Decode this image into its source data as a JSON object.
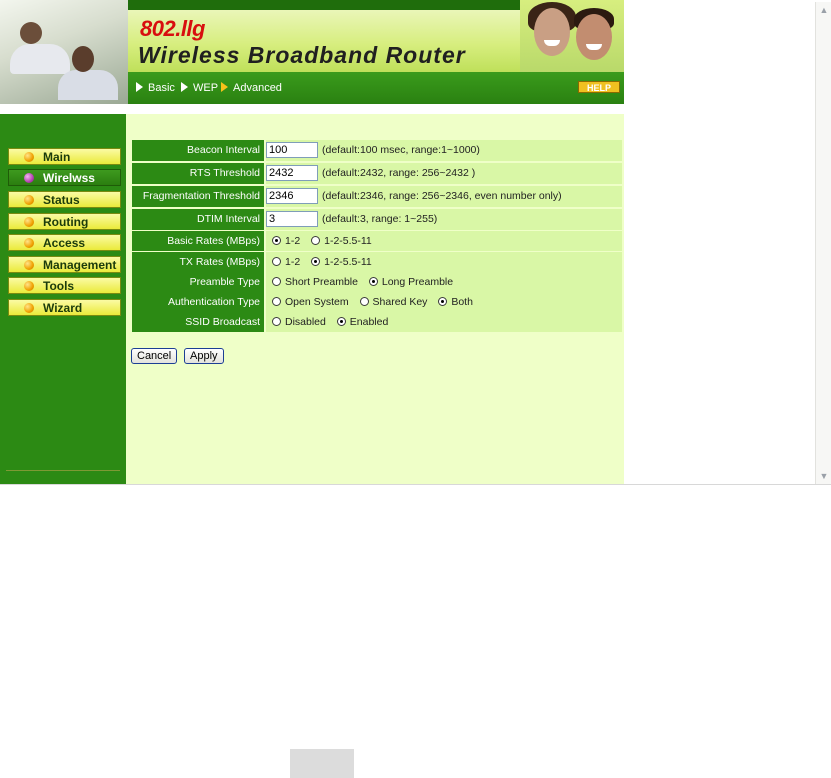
{
  "header": {
    "model": "802.llg",
    "title": "Wireless Broadband Router",
    "breadcrumb": [
      {
        "label": "Basic",
        "active": false
      },
      {
        "label": "WEP",
        "active": false
      },
      {
        "label": "Advanced",
        "active": true
      }
    ],
    "help_label": "HELP"
  },
  "sidebar": {
    "items": [
      {
        "label": "Main",
        "active": false
      },
      {
        "label": "Wirelwss",
        "active": true
      },
      {
        "label": "Status",
        "active": false
      },
      {
        "label": "Routing",
        "active": false
      },
      {
        "label": "Access",
        "active": false
      },
      {
        "label": "Management",
        "active": false
      },
      {
        "label": "Tools",
        "active": false
      },
      {
        "label": "Wizard",
        "active": false
      }
    ]
  },
  "form": {
    "beacon_interval": {
      "label": "Beacon Interval",
      "value": "100",
      "hint": "(default:100 msec, range:1~1000)"
    },
    "rts_threshold": {
      "label": "RTS Threshold",
      "value": "2432",
      "hint": "(default:2432, range: 256~2432 )"
    },
    "fragmentation_threshold": {
      "label": "Fragmentation Threshold",
      "value": "2346",
      "hint": "(default:2346, range: 256~2346, even number only)"
    },
    "dtim_interval": {
      "label": "DTIM Interval",
      "value": "3",
      "hint": "(default:3, range: 1~255)"
    },
    "basic_rates": {
      "label": "Basic Rates (MBps)",
      "options": [
        "1-2",
        "1-2-5.5-11"
      ],
      "selected": "1-2"
    },
    "tx_rates": {
      "label": "TX Rates (MBps)",
      "options": [
        "1-2",
        "1-2-5.5-11"
      ],
      "selected": "1-2-5.5-11"
    },
    "preamble_type": {
      "label": "Preamble Type",
      "options": [
        "Short Preamble",
        "Long Preamble"
      ],
      "selected": "Long Preamble"
    },
    "authentication_type": {
      "label": "Authentication Type",
      "options": [
        "Open System",
        "Shared Key",
        "Both"
      ],
      "selected": "Both"
    },
    "ssid_broadcast": {
      "label": "SSID Broadcast",
      "options": [
        "Disabled",
        "Enabled"
      ],
      "selected": "Enabled"
    }
  },
  "buttons": {
    "cancel": "Cancel",
    "apply": "Apply"
  },
  "colors": {
    "brand_green": "#2c8a14",
    "field_green": "#d9f7a6",
    "content_bg": "#efffc8",
    "menu_yellow": "#eaea3a",
    "model_red": "#d80f0f",
    "help_gold": "#f0c020"
  },
  "icons": {
    "menu_bullet": "orb-icon",
    "breadcrumb_arrow": "triangle-right-icon",
    "scroll_up": "chevron-up-icon",
    "scroll_down": "chevron-down-icon"
  }
}
